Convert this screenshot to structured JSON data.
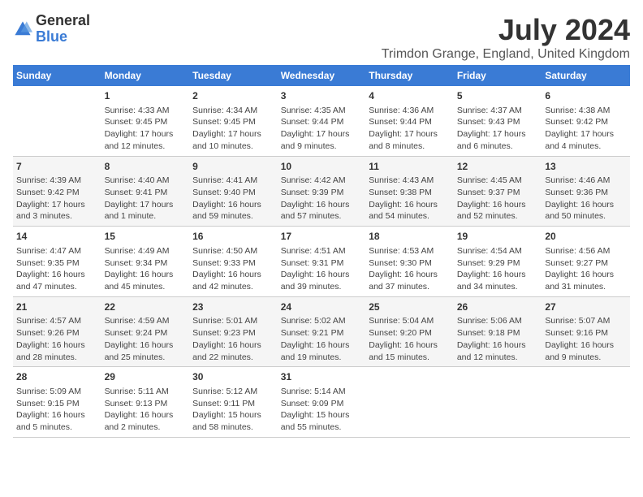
{
  "logo": {
    "line1": "General",
    "line2": "Blue"
  },
  "title": "July 2024",
  "subtitle": "Trimdon Grange, England, United Kingdom",
  "headers": [
    "Sunday",
    "Monday",
    "Tuesday",
    "Wednesday",
    "Thursday",
    "Friday",
    "Saturday"
  ],
  "weeks": [
    [
      {
        "day": "",
        "content": ""
      },
      {
        "day": "1",
        "content": "Sunrise: 4:33 AM\nSunset: 9:45 PM\nDaylight: 17 hours\nand 12 minutes."
      },
      {
        "day": "2",
        "content": "Sunrise: 4:34 AM\nSunset: 9:45 PM\nDaylight: 17 hours\nand 10 minutes."
      },
      {
        "day": "3",
        "content": "Sunrise: 4:35 AM\nSunset: 9:44 PM\nDaylight: 17 hours\nand 9 minutes."
      },
      {
        "day": "4",
        "content": "Sunrise: 4:36 AM\nSunset: 9:44 PM\nDaylight: 17 hours\nand 8 minutes."
      },
      {
        "day": "5",
        "content": "Sunrise: 4:37 AM\nSunset: 9:43 PM\nDaylight: 17 hours\nand 6 minutes."
      },
      {
        "day": "6",
        "content": "Sunrise: 4:38 AM\nSunset: 9:42 PM\nDaylight: 17 hours\nand 4 minutes."
      }
    ],
    [
      {
        "day": "7",
        "content": "Sunrise: 4:39 AM\nSunset: 9:42 PM\nDaylight: 17 hours\nand 3 minutes."
      },
      {
        "day": "8",
        "content": "Sunrise: 4:40 AM\nSunset: 9:41 PM\nDaylight: 17 hours\nand 1 minute."
      },
      {
        "day": "9",
        "content": "Sunrise: 4:41 AM\nSunset: 9:40 PM\nDaylight: 16 hours\nand 59 minutes."
      },
      {
        "day": "10",
        "content": "Sunrise: 4:42 AM\nSunset: 9:39 PM\nDaylight: 16 hours\nand 57 minutes."
      },
      {
        "day": "11",
        "content": "Sunrise: 4:43 AM\nSunset: 9:38 PM\nDaylight: 16 hours\nand 54 minutes."
      },
      {
        "day": "12",
        "content": "Sunrise: 4:45 AM\nSunset: 9:37 PM\nDaylight: 16 hours\nand 52 minutes."
      },
      {
        "day": "13",
        "content": "Sunrise: 4:46 AM\nSunset: 9:36 PM\nDaylight: 16 hours\nand 50 minutes."
      }
    ],
    [
      {
        "day": "14",
        "content": "Sunrise: 4:47 AM\nSunset: 9:35 PM\nDaylight: 16 hours\nand 47 minutes."
      },
      {
        "day": "15",
        "content": "Sunrise: 4:49 AM\nSunset: 9:34 PM\nDaylight: 16 hours\nand 45 minutes."
      },
      {
        "day": "16",
        "content": "Sunrise: 4:50 AM\nSunset: 9:33 PM\nDaylight: 16 hours\nand 42 minutes."
      },
      {
        "day": "17",
        "content": "Sunrise: 4:51 AM\nSunset: 9:31 PM\nDaylight: 16 hours\nand 39 minutes."
      },
      {
        "day": "18",
        "content": "Sunrise: 4:53 AM\nSunset: 9:30 PM\nDaylight: 16 hours\nand 37 minutes."
      },
      {
        "day": "19",
        "content": "Sunrise: 4:54 AM\nSunset: 9:29 PM\nDaylight: 16 hours\nand 34 minutes."
      },
      {
        "day": "20",
        "content": "Sunrise: 4:56 AM\nSunset: 9:27 PM\nDaylight: 16 hours\nand 31 minutes."
      }
    ],
    [
      {
        "day": "21",
        "content": "Sunrise: 4:57 AM\nSunset: 9:26 PM\nDaylight: 16 hours\nand 28 minutes."
      },
      {
        "day": "22",
        "content": "Sunrise: 4:59 AM\nSunset: 9:24 PM\nDaylight: 16 hours\nand 25 minutes."
      },
      {
        "day": "23",
        "content": "Sunrise: 5:01 AM\nSunset: 9:23 PM\nDaylight: 16 hours\nand 22 minutes."
      },
      {
        "day": "24",
        "content": "Sunrise: 5:02 AM\nSunset: 9:21 PM\nDaylight: 16 hours\nand 19 minutes."
      },
      {
        "day": "25",
        "content": "Sunrise: 5:04 AM\nSunset: 9:20 PM\nDaylight: 16 hours\nand 15 minutes."
      },
      {
        "day": "26",
        "content": "Sunrise: 5:06 AM\nSunset: 9:18 PM\nDaylight: 16 hours\nand 12 minutes."
      },
      {
        "day": "27",
        "content": "Sunrise: 5:07 AM\nSunset: 9:16 PM\nDaylight: 16 hours\nand 9 minutes."
      }
    ],
    [
      {
        "day": "28",
        "content": "Sunrise: 5:09 AM\nSunset: 9:15 PM\nDaylight: 16 hours\nand 5 minutes."
      },
      {
        "day": "29",
        "content": "Sunrise: 5:11 AM\nSunset: 9:13 PM\nDaylight: 16 hours\nand 2 minutes."
      },
      {
        "day": "30",
        "content": "Sunrise: 5:12 AM\nSunset: 9:11 PM\nDaylight: 15 hours\nand 58 minutes."
      },
      {
        "day": "31",
        "content": "Sunrise: 5:14 AM\nSunset: 9:09 PM\nDaylight: 15 hours\nand 55 minutes."
      },
      {
        "day": "",
        "content": ""
      },
      {
        "day": "",
        "content": ""
      },
      {
        "day": "",
        "content": ""
      }
    ]
  ]
}
